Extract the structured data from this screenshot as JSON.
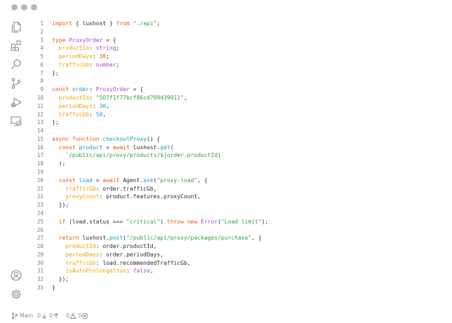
{
  "window": {
    "traffic_lights": [
      "close",
      "minimize",
      "maximize"
    ]
  },
  "activity_bar": {
    "top_icons": [
      "files-icon",
      "extensions-icon",
      "search-icon",
      "source-control-icon",
      "run-debug-icon",
      "remote-explorer-icon"
    ],
    "bottom_icons": [
      "account-icon",
      "settings-icon"
    ]
  },
  "editor": {
    "lines": [
      {
        "n": "1",
        "t": [
          [
            "kw",
            "import"
          ],
          [
            "pl",
            " { luxhost } "
          ],
          [
            "kw",
            "from"
          ],
          [
            "pl",
            " "
          ],
          [
            "st",
            "\"./api\""
          ],
          [
            "pl",
            ";"
          ]
        ]
      },
      {
        "n": "2",
        "t": []
      },
      {
        "n": "3",
        "t": [
          [
            "kw",
            "type"
          ],
          [
            "pl",
            " "
          ],
          [
            "ty",
            "ProxyOrder"
          ],
          [
            "pl",
            " = {"
          ]
        ]
      },
      {
        "n": "4",
        "t": [
          [
            "pl",
            "  "
          ],
          [
            "pr",
            "productId"
          ],
          [
            "pl",
            ": "
          ],
          [
            "ty",
            "string"
          ],
          [
            "pl",
            ";"
          ]
        ]
      },
      {
        "n": "5",
        "t": [
          [
            "pl",
            "  "
          ],
          [
            "pr",
            "periodDays"
          ],
          [
            "pl",
            ": "
          ],
          [
            "nu",
            "30"
          ],
          [
            "pl",
            ";"
          ]
        ]
      },
      {
        "n": "6",
        "t": [
          [
            "pl",
            "  "
          ],
          [
            "pr",
            "trafficGb"
          ],
          [
            "pl",
            ": "
          ],
          [
            "ty",
            "number"
          ],
          [
            "pl",
            ";"
          ]
        ]
      },
      {
        "n": "7",
        "t": [
          [
            "pl",
            "};"
          ]
        ]
      },
      {
        "n": "8",
        "t": []
      },
      {
        "n": "9",
        "t": [
          [
            "kw",
            "const"
          ],
          [
            "pl",
            " "
          ],
          [
            "fn",
            "order"
          ],
          [
            "pl",
            ": "
          ],
          [
            "ty",
            "ProxyOrder"
          ],
          [
            "pl",
            " = {"
          ]
        ]
      },
      {
        "n": "10",
        "t": [
          [
            "pl",
            "  "
          ],
          [
            "pr",
            "productId"
          ],
          [
            "pl",
            ": "
          ],
          [
            "st",
            "\"5O7f1f77bcf86cd799439011\""
          ],
          [
            "pl",
            ","
          ]
        ]
      },
      {
        "n": "11",
        "t": [
          [
            "pl",
            "  "
          ],
          [
            "pr",
            "periodDays"
          ],
          [
            "pl",
            ": "
          ],
          [
            "fn",
            "30"
          ],
          [
            "pl",
            ","
          ]
        ]
      },
      {
        "n": "12",
        "t": [
          [
            "pl",
            "  "
          ],
          [
            "pr",
            "trafficGb"
          ],
          [
            "pl",
            ": "
          ],
          [
            "fn",
            "50"
          ],
          [
            "pl",
            ","
          ]
        ]
      },
      {
        "n": "13",
        "t": [
          [
            "pl",
            "};"
          ]
        ]
      },
      {
        "n": "14",
        "t": []
      },
      {
        "n": "15",
        "t": [
          [
            "kw",
            "async"
          ],
          [
            "pl",
            " "
          ],
          [
            "kw",
            "function"
          ],
          [
            "pl",
            " "
          ],
          [
            "fn",
            "checkoutProxy"
          ],
          [
            "pl",
            "() {"
          ]
        ]
      },
      {
        "n": "16",
        "t": [
          [
            "pl",
            "  "
          ],
          [
            "kw",
            "const"
          ],
          [
            "pl",
            " "
          ],
          [
            "fn",
            "product"
          ],
          [
            "pl",
            " = "
          ],
          [
            "kw",
            "await"
          ],
          [
            "pl",
            " luxhost."
          ],
          [
            "fn",
            "get"
          ],
          [
            "pl",
            "("
          ]
        ]
      },
      {
        "n": "17",
        "t": [
          [
            "pl",
            "    "
          ],
          [
            "st",
            "`/public/api/proxy/products/${order.productId}`"
          ]
        ]
      },
      {
        "n": "18",
        "t": [
          [
            "pl",
            "  );"
          ]
        ]
      },
      {
        "n": "19",
        "t": []
      },
      {
        "n": "20",
        "t": [
          [
            "pl",
            "  "
          ],
          [
            "kw",
            "const"
          ],
          [
            "pl",
            " "
          ],
          [
            "fn",
            "load"
          ],
          [
            "pl",
            " = "
          ],
          [
            "kw",
            "await"
          ],
          [
            "pl",
            " Agent."
          ],
          [
            "fn",
            "ask"
          ],
          [
            "pl",
            "("
          ],
          [
            "st",
            "\"proxy-load\""
          ],
          [
            "pl",
            ", {"
          ]
        ]
      },
      {
        "n": "21",
        "t": [
          [
            "pl",
            "    "
          ],
          [
            "pr",
            "trafficGb"
          ],
          [
            "pl",
            ": order.trafficGb,"
          ]
        ]
      },
      {
        "n": "22",
        "t": [
          [
            "pl",
            "    "
          ],
          [
            "pr",
            "proxyCount"
          ],
          [
            "pl",
            ": product.features.proxyCount,"
          ]
        ]
      },
      {
        "n": "23",
        "t": [
          [
            "pl",
            "  });"
          ]
        ]
      },
      {
        "n": "24",
        "t": []
      },
      {
        "n": "25",
        "t": [
          [
            "pl",
            "  "
          ],
          [
            "kw",
            "if"
          ],
          [
            "pl",
            " (load.status === "
          ],
          [
            "st",
            "\"critical\""
          ],
          [
            "pl",
            ") "
          ],
          [
            "kw",
            "throw"
          ],
          [
            "pl",
            " "
          ],
          [
            "kw",
            "new"
          ],
          [
            "pl",
            " "
          ],
          [
            "ty",
            "Error"
          ],
          [
            "pl",
            "("
          ],
          [
            "st",
            "\"Load limit\""
          ],
          [
            "pl",
            ");"
          ]
        ]
      },
      {
        "n": "26",
        "t": []
      },
      {
        "n": "27",
        "t": [
          [
            "pl",
            "  "
          ],
          [
            "kw",
            "return"
          ],
          [
            "pl",
            " luxhost."
          ],
          [
            "fn",
            "post"
          ],
          [
            "pl",
            "("
          ],
          [
            "st",
            "\"/public/api/proxy/packages/purchase\""
          ],
          [
            "pl",
            ", {"
          ]
        ]
      },
      {
        "n": "28",
        "t": [
          [
            "pl",
            "    "
          ],
          [
            "pr",
            "productId"
          ],
          [
            "pl",
            ": order.productId,"
          ]
        ]
      },
      {
        "n": "29",
        "t": [
          [
            "pl",
            "    "
          ],
          [
            "pr",
            "periodDays"
          ],
          [
            "pl",
            ": order.periodDays,"
          ]
        ]
      },
      {
        "n": "30",
        "t": [
          [
            "pl",
            "    "
          ],
          [
            "pr",
            "trafficGb"
          ],
          [
            "pl",
            ": load.recommendedTrafficGb,"
          ]
        ]
      },
      {
        "n": "31",
        "t": [
          [
            "pl",
            "    "
          ],
          [
            "pr",
            "isAutoProlongation"
          ],
          [
            "pl",
            ": "
          ],
          [
            "ty",
            "false"
          ],
          [
            "pl",
            ","
          ]
        ]
      },
      {
        "n": "32",
        "t": [
          [
            "pl",
            "  });"
          ]
        ]
      },
      {
        "n": "33",
        "t": [
          [
            "pl",
            "}"
          ]
        ]
      }
    ]
  },
  "status_bar": {
    "branch": "Main",
    "incoming": "0",
    "outgoing": "0",
    "warnings": "0",
    "errors": "0"
  }
}
